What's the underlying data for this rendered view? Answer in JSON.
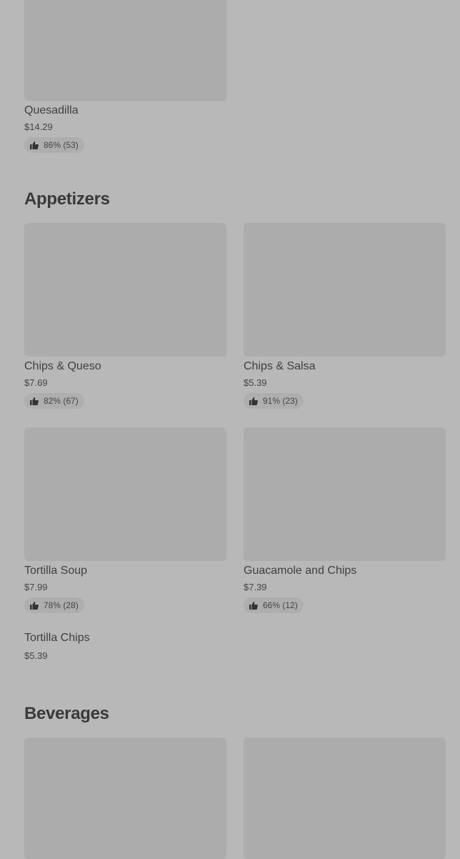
{
  "sections": {
    "mains": {
      "items": [
        {
          "name": "Quesadilla",
          "price": "$14.29",
          "rating": "86% (53)"
        }
      ]
    },
    "appetizers": {
      "title": "Appetizers",
      "items": [
        {
          "name": "Chips & Queso",
          "price": "$7.69",
          "rating": "82% (67)"
        },
        {
          "name": "Chips & Salsa",
          "price": "$5.39",
          "rating": "91% (23)"
        },
        {
          "name": "Tortilla Soup",
          "price": "$7.99",
          "rating": "78% (28)"
        },
        {
          "name": "Guacamole and Chips",
          "price": "$7.39",
          "rating": "66% (12)"
        },
        {
          "name": "Tortilla Chips",
          "price": "$5.39"
        }
      ]
    },
    "beverages": {
      "title": "Beverages"
    }
  },
  "icons": {
    "rating": "thumbs-up-icon"
  },
  "colors": {
    "background": "#b8b8b8",
    "image_placeholder": "#acacac",
    "badge": "#aeaeae",
    "text": "#3a3a3a"
  }
}
